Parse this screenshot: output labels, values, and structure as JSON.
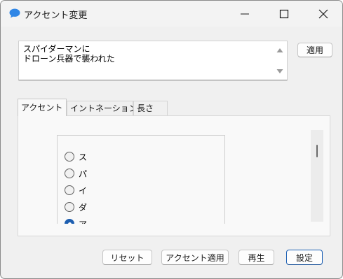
{
  "window": {
    "title": "アクセント変更",
    "app_icon": "speech-bubble-icon",
    "accent_color": "#1d5eb0",
    "controls": {
      "minimize": "minimize-icon",
      "maximize": "maximize-icon",
      "close": "close-icon"
    }
  },
  "input": {
    "text": "スパイダーマンに\nドローン兵器で襲われた"
  },
  "buttons": {
    "apply": "適用",
    "reset": "リセット",
    "accent_apply": "アクセント適用",
    "play": "再生",
    "settings": "設定"
  },
  "tabs": [
    {
      "label": "アクセント",
      "active": true
    },
    {
      "label": "イントネーション",
      "active": false
    },
    {
      "label": "長さ",
      "active": false
    }
  ],
  "accent_list": [
    {
      "label": "ス",
      "checked": false
    },
    {
      "label": "パ",
      "checked": false
    },
    {
      "label": "イ",
      "checked": false
    },
    {
      "label": "ダ",
      "checked": false
    },
    {
      "label": "ア",
      "checked": true
    }
  ]
}
